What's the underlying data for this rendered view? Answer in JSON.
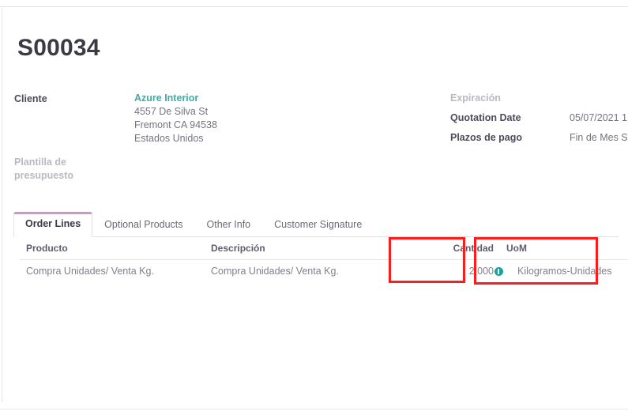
{
  "document": {
    "title": "S00034"
  },
  "left_fields": {
    "customer_label": "Cliente",
    "customer_name": "Azure Interior",
    "address_line1": "4557 De Silva St",
    "address_line2": "Fremont CA 94538",
    "address_country": "Estados Unidos",
    "template_label_line1": "Plantilla de",
    "template_label_line2": "presupuesto"
  },
  "right_fields": {
    "expiration_label": "Expiración",
    "expiration_value": "",
    "quotation_date_label": "Quotation Date",
    "quotation_date_value": "05/07/2021 1",
    "payment_terms_label": "Plazos de pago",
    "payment_terms_value": "Fin de Mes S"
  },
  "tabs": [
    {
      "label": "Order Lines",
      "active": true
    },
    {
      "label": "Optional Products",
      "active": false
    },
    {
      "label": "Other Info",
      "active": false
    },
    {
      "label": "Customer Signature",
      "active": false
    }
  ],
  "order_lines": {
    "headers": {
      "producto": "Producto",
      "descripcion": "Descripción",
      "cantidad": "Cantidad",
      "uom": "UoM"
    },
    "rows": [
      {
        "producto": "Compra Unidades/ Venta Kg.",
        "descripcion": "Compra Unidades/ Venta Kg.",
        "cantidad": "2,000",
        "uom": "Kilogramos-Unidades",
        "uom_icon": "info-circle-icon"
      }
    ]
  },
  "annotations": [
    {
      "name": "cantidad-highlight",
      "color": "#fb1c1c"
    },
    {
      "name": "uom-highlight",
      "color": "#fb1c1c"
    }
  ],
  "colors": {
    "link_teal": "#3cada6",
    "tab_accent": "#bfa2b8",
    "annotation_red": "#fb1c1c",
    "info_icon_teal": "#17a2a2"
  }
}
